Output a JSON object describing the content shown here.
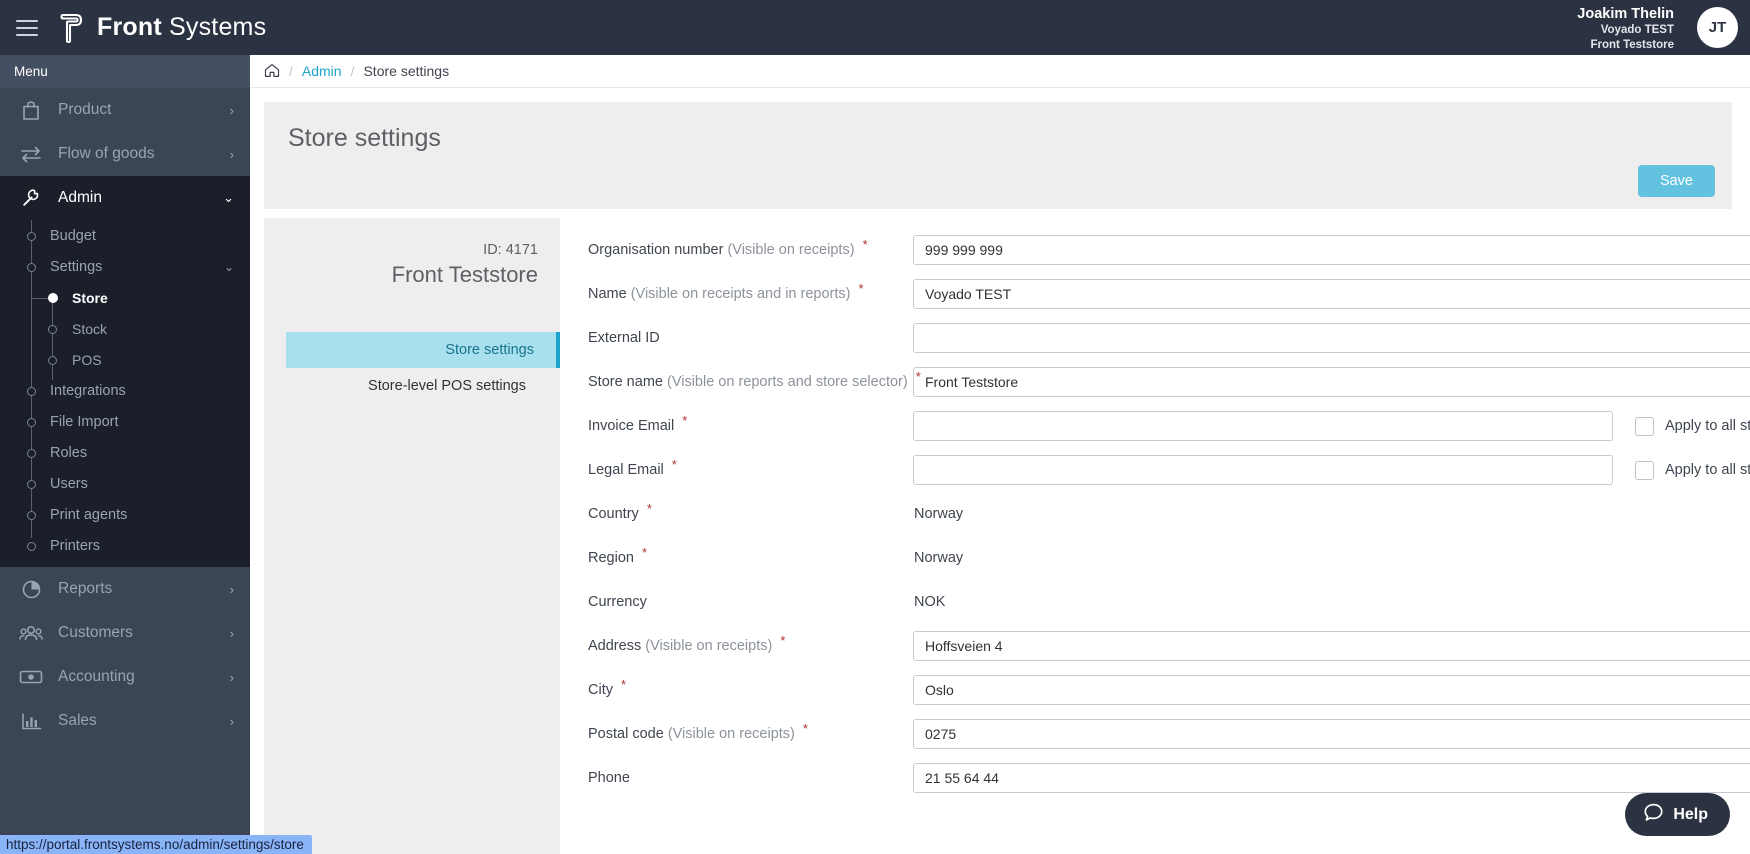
{
  "header": {
    "brand_bold": "Front",
    "brand_light": "Systems",
    "menu_icon": "hamburger-icon",
    "logo_icon": "front-systems-logo",
    "user": {
      "name": "Joakim Thelin",
      "org": "Voyado TEST",
      "store": "Front Teststore",
      "initials": "JT"
    }
  },
  "sidebar": {
    "menu_label": "Menu",
    "groups": [
      {
        "label": "Product",
        "icon": "bag-icon",
        "chevron": "›",
        "active": false
      },
      {
        "label": "Flow of goods",
        "icon": "transfer-icon",
        "chevron": "›",
        "active": false
      },
      {
        "label": "Admin",
        "icon": "wrench-icon",
        "chevron": "⌄",
        "active": true
      }
    ],
    "admin_items": [
      {
        "label": "Budget"
      },
      {
        "label": "Settings",
        "chevron": "⌄"
      },
      {
        "label": "Store",
        "level": 2,
        "selected": true
      },
      {
        "label": "Stock",
        "level": 2
      },
      {
        "label": "POS",
        "level": 2
      },
      {
        "label": "Integrations"
      },
      {
        "label": "File Import"
      },
      {
        "label": "Roles"
      },
      {
        "label": "Users"
      },
      {
        "label": "Print agents"
      },
      {
        "label": "Printers"
      }
    ],
    "lower_groups": [
      {
        "label": "Reports",
        "icon": "pie-chart-icon",
        "chevron": "›"
      },
      {
        "label": "Customers",
        "icon": "people-icon",
        "chevron": "›"
      },
      {
        "label": "Accounting",
        "icon": "money-icon",
        "chevron": "›"
      },
      {
        "label": "Sales",
        "icon": "bar-chart-icon",
        "chevron": "›"
      }
    ]
  },
  "breadcrumb": {
    "home_icon": "home-icon",
    "sep": "/",
    "link": "Admin",
    "current": "Store settings"
  },
  "page": {
    "title": "Store settings",
    "save_label": "Save"
  },
  "infocard": {
    "id_label": "ID: 4171",
    "store_name": "Front Teststore",
    "tabs": [
      {
        "label": "Store settings",
        "selected": true
      },
      {
        "label": "Store-level POS settings",
        "selected": false
      }
    ]
  },
  "form": {
    "required_mark": "*",
    "apply_all_label": "Apply to all stores",
    "fields": [
      {
        "label": "Organisation number",
        "hint": "(Visible on receipts)",
        "required": true,
        "type": "input",
        "value": "999 999 999"
      },
      {
        "label": "Name",
        "hint": "(Visible on receipts and in reports)",
        "required": true,
        "type": "input",
        "value": "Voyado TEST"
      },
      {
        "label": "External ID",
        "hint": "",
        "required": false,
        "type": "input",
        "value": ""
      },
      {
        "label": "Store name",
        "hint": "(Visible on reports and store selector)",
        "required": true,
        "type": "input",
        "value": "Front Teststore"
      },
      {
        "label": "Invoice Email",
        "hint": "",
        "required": true,
        "type": "input-apply",
        "value": ""
      },
      {
        "label": "Legal Email",
        "hint": "",
        "required": true,
        "type": "input-apply",
        "value": ""
      },
      {
        "label": "Country",
        "hint": "",
        "required": true,
        "type": "static",
        "value": "Norway"
      },
      {
        "label": "Region",
        "hint": "",
        "required": true,
        "type": "static",
        "value": "Norway"
      },
      {
        "label": "Currency",
        "hint": "",
        "required": false,
        "type": "static",
        "value": "NOK"
      },
      {
        "label": "Address",
        "hint": "(Visible on receipts)",
        "required": true,
        "type": "input",
        "value": "Hoffsveien 4"
      },
      {
        "label": "City",
        "hint": "",
        "required": true,
        "type": "input",
        "value": "Oslo"
      },
      {
        "label": "Postal code",
        "hint": "(Visible on receipts)",
        "required": true,
        "type": "input",
        "value": "0275"
      },
      {
        "label": "Phone",
        "hint": "",
        "required": false,
        "type": "input",
        "value": "21 55 64 44"
      }
    ]
  },
  "help": {
    "label": "Help",
    "icon": "chat-bubble-icon"
  },
  "status_url": "https://portal.frontsystems.no/admin/settings/store",
  "colors": {
    "topbar": "#2b3241",
    "sidebar": "#3c4556",
    "sidebar_active": "#1b1f2a",
    "accent": "#1ca5cc",
    "save_button": "#62c2df",
    "tab_selected": "#a9e0ee",
    "required": "#b03030"
  }
}
